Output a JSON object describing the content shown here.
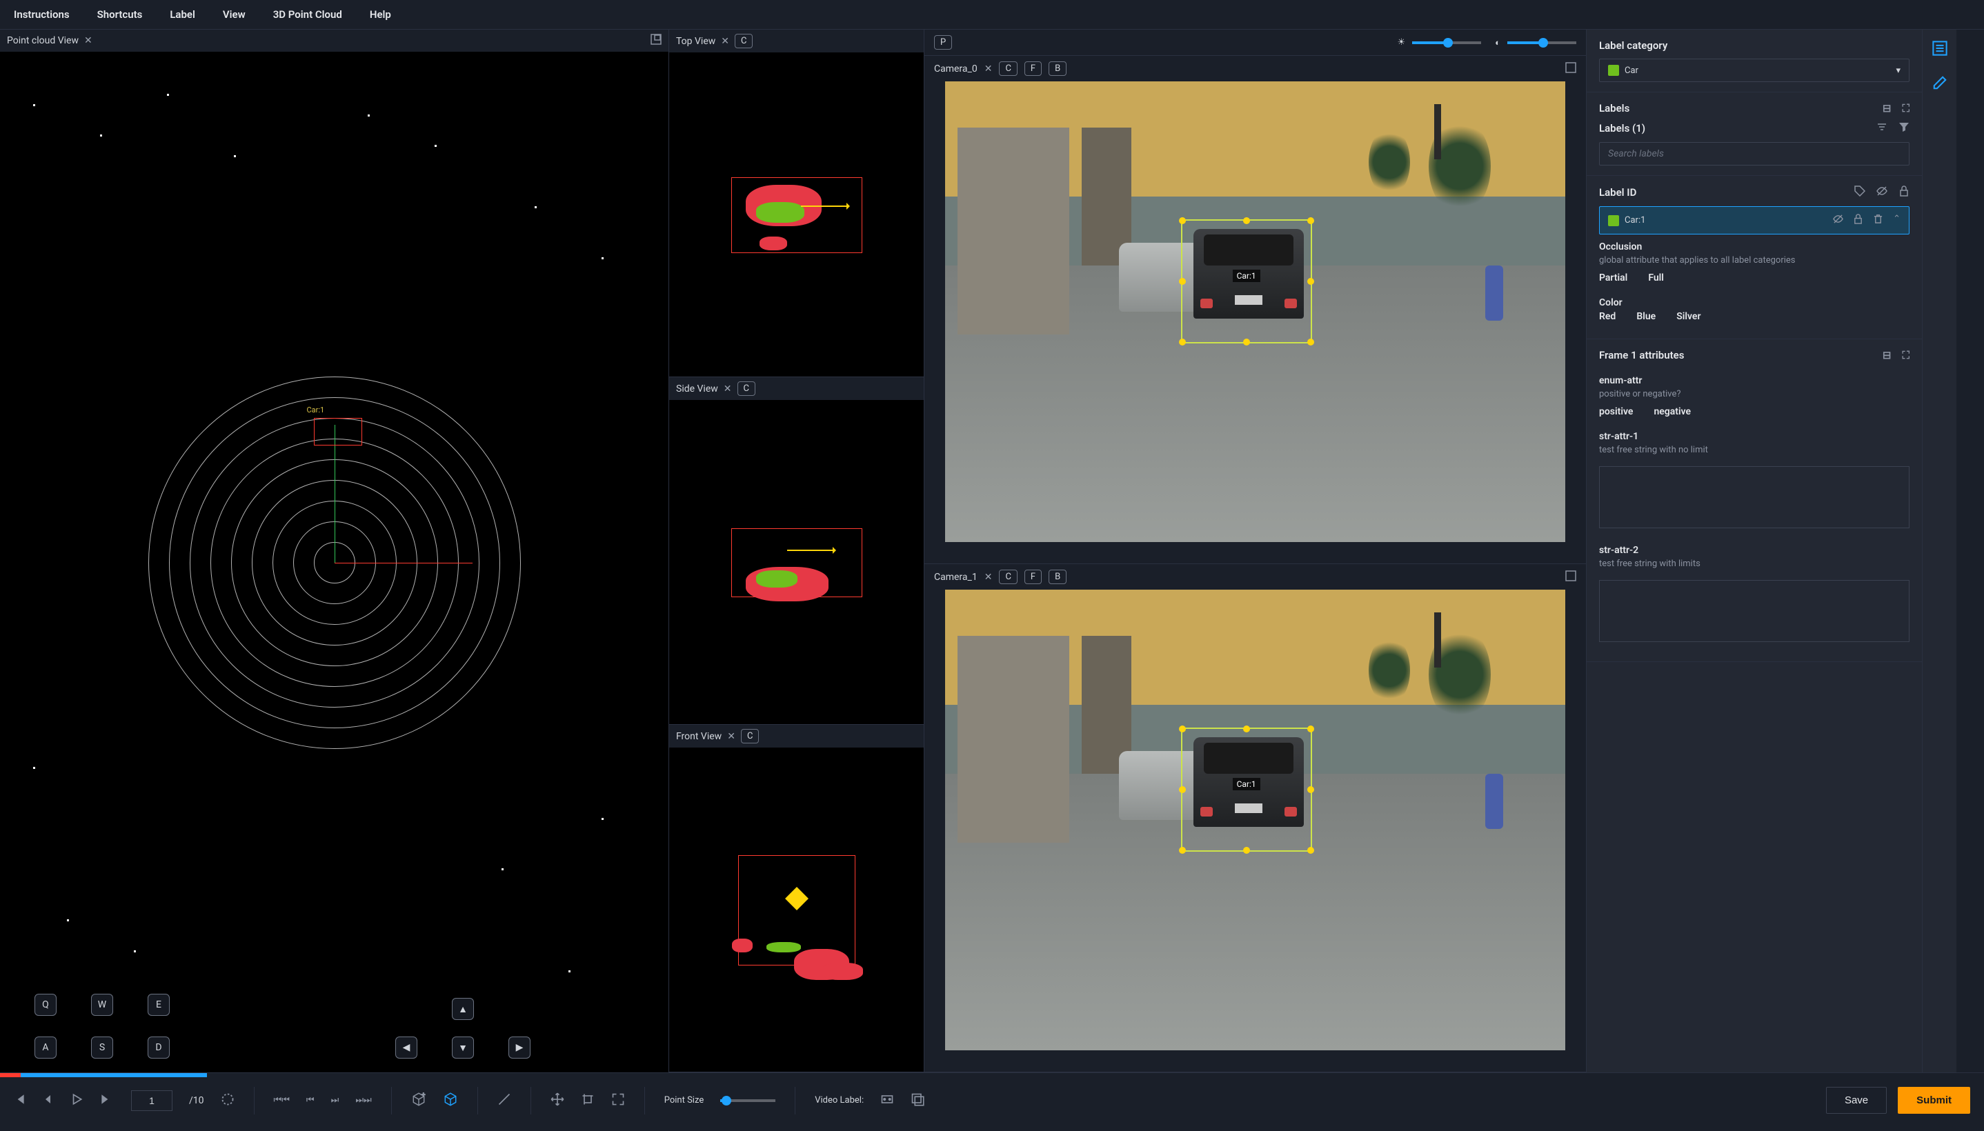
{
  "menu": [
    "Instructions",
    "Shortcuts",
    "Label",
    "View",
    "3D Point Cloud",
    "Help"
  ],
  "panels": {
    "pointCloud": "Point cloud View",
    "top": "Top View",
    "side": "Side View",
    "front": "Front View",
    "pcLabel": "Car:1"
  },
  "cams": {
    "cam0": "Camera_0",
    "cam1": "Camera_1",
    "labelTag": "Car:1"
  },
  "keys": {
    "P": "P",
    "C": "C",
    "F": "F",
    "B": "B",
    "Q": "Q",
    "W": "W",
    "E": "E",
    "A": "A",
    "S": "S",
    "D": "D"
  },
  "sidebar": {
    "labelCategory": "Label category",
    "category": "Car",
    "categoryColor": "#6fbf1e",
    "labelsHeader": "Labels",
    "labelsCount": "Labels (1)",
    "searchPlaceholder": "Search labels",
    "labelIdHeader": "Label ID",
    "labelIdValue": "Car:1",
    "occlusion": {
      "title": "Occlusion",
      "desc": "global attribute that applies to all label categories",
      "options": [
        "Partial",
        "Full"
      ]
    },
    "color": {
      "title": "Color",
      "options": [
        "Red",
        "Blue",
        "Silver"
      ]
    },
    "frameAttr": "Frame 1 attributes",
    "enum": {
      "title": "enum-attr",
      "desc": "positive or negative?",
      "options": [
        "positive",
        "negative"
      ]
    },
    "str1": {
      "title": "str-attr-1",
      "desc": "test free string with no limit"
    },
    "str2": {
      "title": "str-attr-2",
      "desc": "test free string with limits"
    }
  },
  "bottom": {
    "currentFrame": "1",
    "totalFrames": "/10",
    "pointSize": "Point Size",
    "videoLabel": "Video Label:",
    "save": "Save",
    "submit": "Submit"
  }
}
